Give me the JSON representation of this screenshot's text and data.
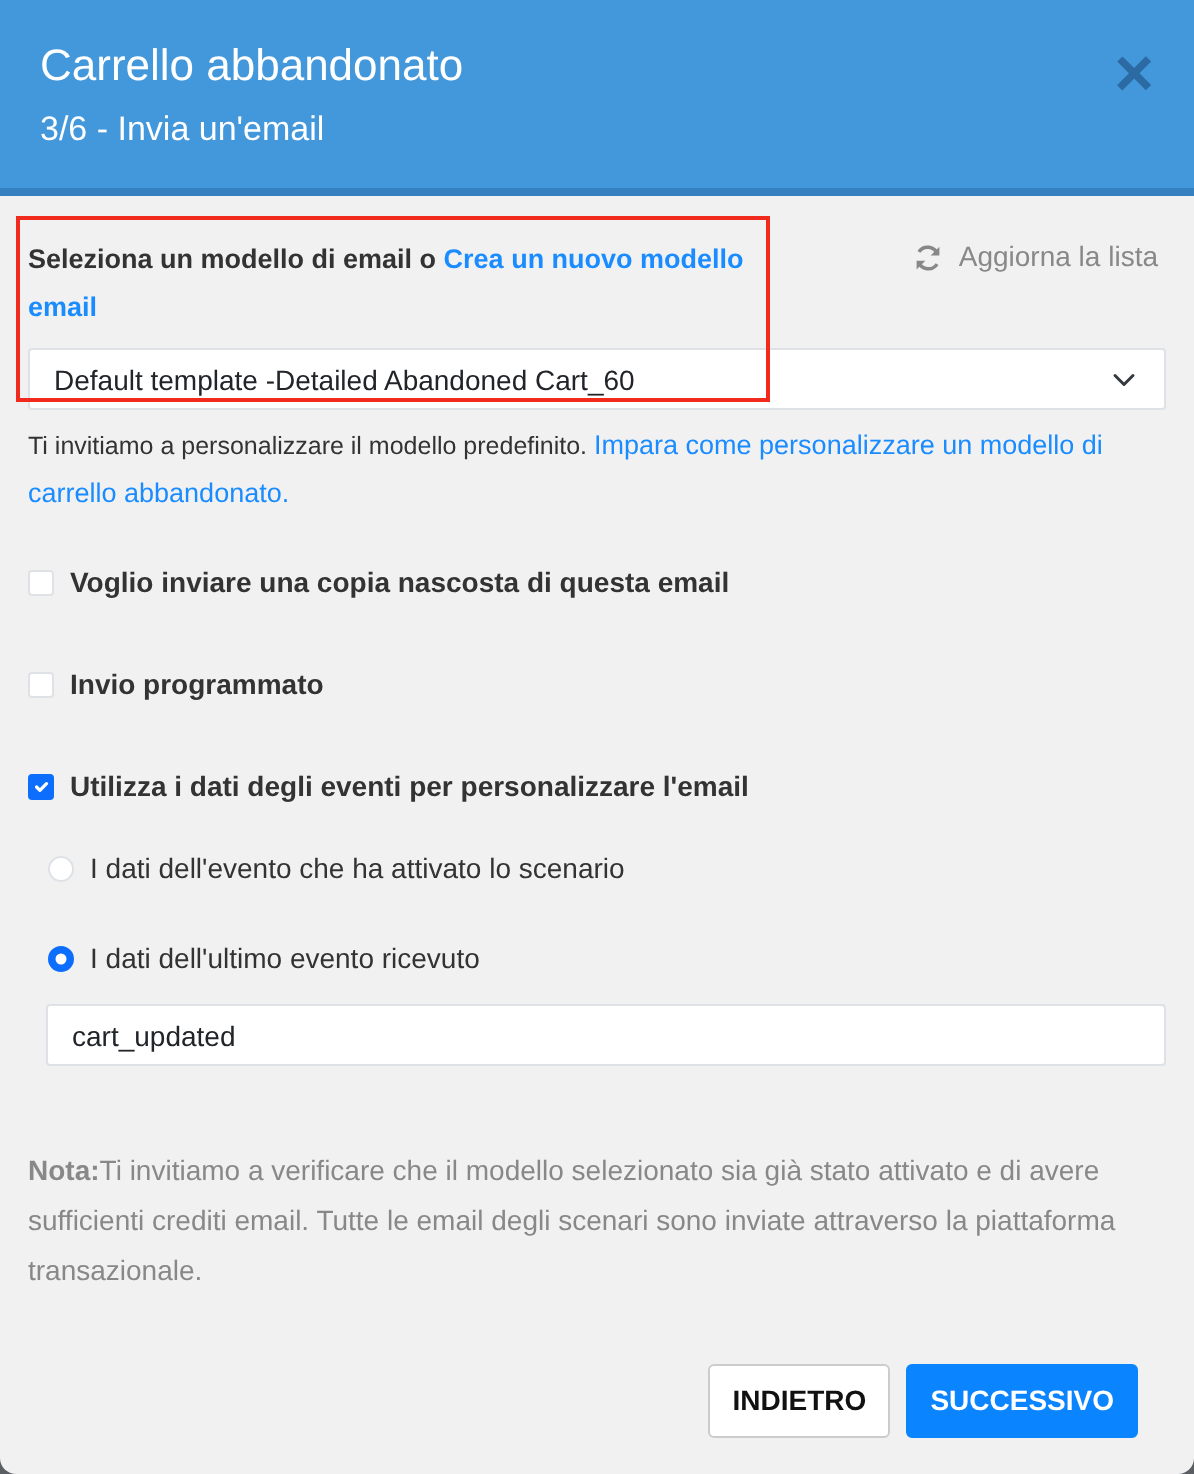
{
  "modal": {
    "title": "Carrello abbandonato",
    "subtitle": "3/6 - Invia un'email",
    "close": "×"
  },
  "template": {
    "highlighted": true,
    "label": "Seleziona un modello di email o",
    "link": [
      "Crea un nuovo modello",
      "email"
    ],
    "refresh": "Aggiorna la lista",
    "value": "Default template -Detailed Abandoned Cart_60",
    "help": "Ti invitiamo a personalizzare il modello predefinito.",
    "help_link": [
      "Impara come personalizzare un modello di",
      "carrello abbandonato."
    ]
  },
  "options": [
    {
      "label": "Voglio inviare una copia nascosta di questa email",
      "checked": false
    },
    {
      "label": "Invio programmato",
      "checked": false
    },
    {
      "label": "Utilizza i dati degli eventi per personalizzare l'email",
      "checked": true
    }
  ],
  "event_source": [
    {
      "label": "I dati dell'evento che ha attivato lo scenario",
      "selected": false
    },
    {
      "label": "I dati dell'ultimo evento ricevuto",
      "selected": true
    }
  ],
  "event_name": "cart_updated",
  "note": "**Nota:**Ti invitiamo a verificare che il modello selezionato sia già stato attivato e di avere sufficienti crediti email. Tutte le email degli scenari sono inviate attraverso la piattaforma transazionale.",
  "buttons": [
    {
      "label": "INDIETRO",
      "kind": "secondary"
    },
    {
      "label": "SUCCESSIVO",
      "kind": "primary"
    }
  ]
}
